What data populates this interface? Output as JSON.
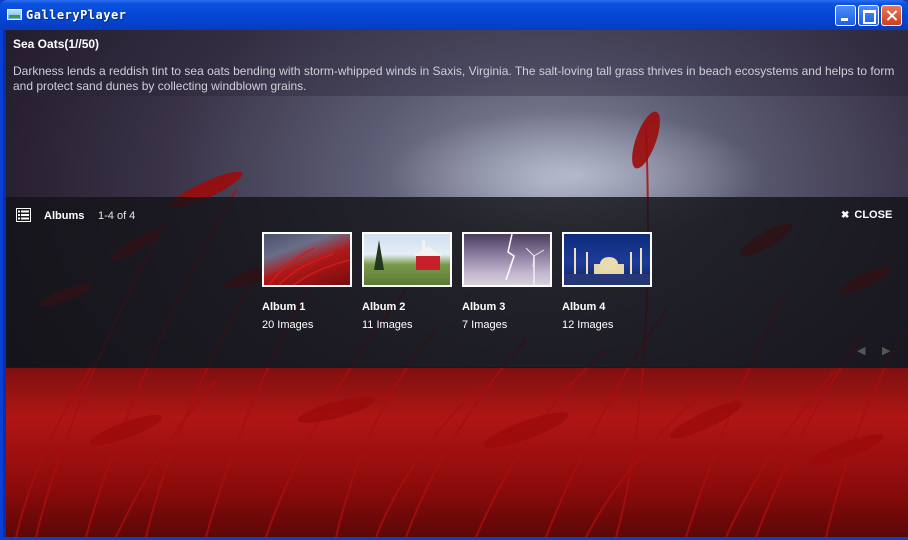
{
  "window": {
    "title": "GalleryPlayer"
  },
  "photo": {
    "title": "Sea Oats(1//50)",
    "description": "Darkness lends a reddish tint to sea oats bending with storm-whipped winds in Saxis, Virginia. The salt-loving tall grass thrives in beach ecosystems and helps to form and protect sand dunes by collecting windblown grains."
  },
  "albums_panel": {
    "title": "Albums",
    "range": "1-4 of 4",
    "close_label": "CLOSE",
    "albums": [
      {
        "name": "Album 1",
        "count": "20 Images",
        "thumb": "red-grass"
      },
      {
        "name": "Album 2",
        "count": "11 Images",
        "thumb": "red-barn"
      },
      {
        "name": "Album 3",
        "count": "7 Images",
        "thumb": "lightning-windmill"
      },
      {
        "name": "Album 4",
        "count": "12 Images",
        "thumb": "mosque-night"
      }
    ]
  },
  "icons": {
    "list": "list-icon",
    "close": "close-icon",
    "prev": "prev-arrow-icon",
    "next": "next-arrow-icon"
  }
}
